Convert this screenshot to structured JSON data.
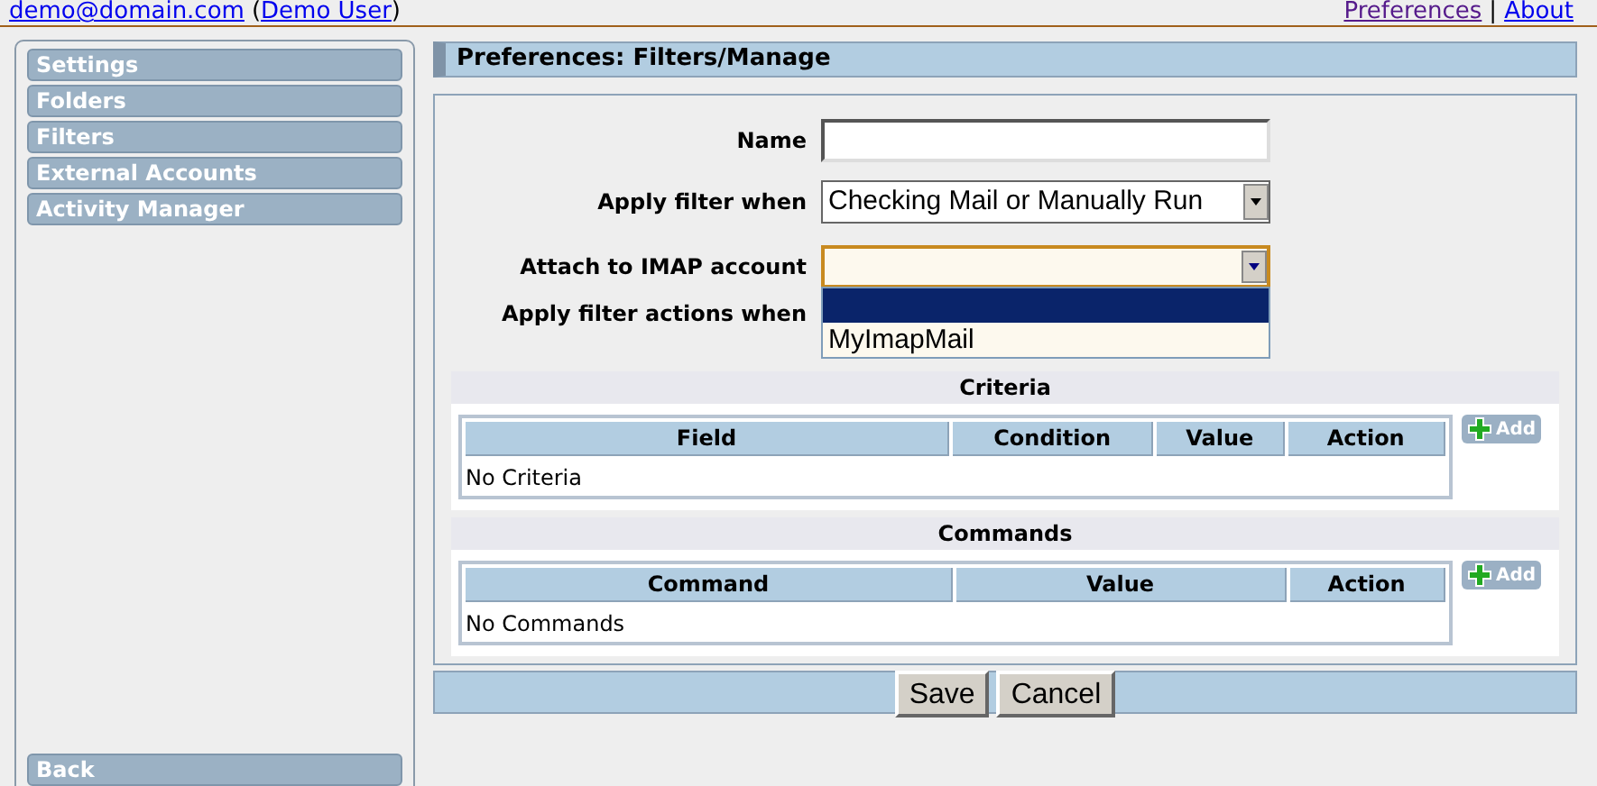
{
  "top_bar": {
    "user_link": "demo@domain.com",
    "open_paren": "(",
    "user_name_link": "Demo User",
    "close_paren": ")",
    "links": [
      {
        "label": "Preferences",
        "visited": true
      },
      {
        "label": "About",
        "visited": false
      }
    ],
    "separator": "|"
  },
  "sidebar": {
    "items": [
      {
        "label": "Settings"
      },
      {
        "label": "Folders"
      },
      {
        "label": "Filters"
      },
      {
        "label": "External Accounts"
      },
      {
        "label": "Activity Manager"
      }
    ],
    "back": "Back"
  },
  "header": "Preferences: Filters/Manage",
  "form": {
    "name_label": "Name",
    "apply_label": "Apply filter when",
    "apply_value": "Checking Mail or Manually Run",
    "attach_label": "Attach to IMAP account",
    "attach_options": [
      {
        "selected": true
      },
      {
        "label": "MyImapMail",
        "selected": false
      }
    ],
    "actions_label": "Apply filter actions when"
  },
  "criteria": {
    "title": "Criteria",
    "columns": [
      "Field",
      "Condition",
      "Value",
      "Action"
    ],
    "empty": "No Criteria",
    "add": "Add"
  },
  "commands": {
    "title": "Commands",
    "columns": [
      "Command",
      "Value",
      "Action"
    ],
    "empty": "No Commands",
    "add": "Add"
  },
  "buttons": [
    "Save",
    "Cancel"
  ]
}
